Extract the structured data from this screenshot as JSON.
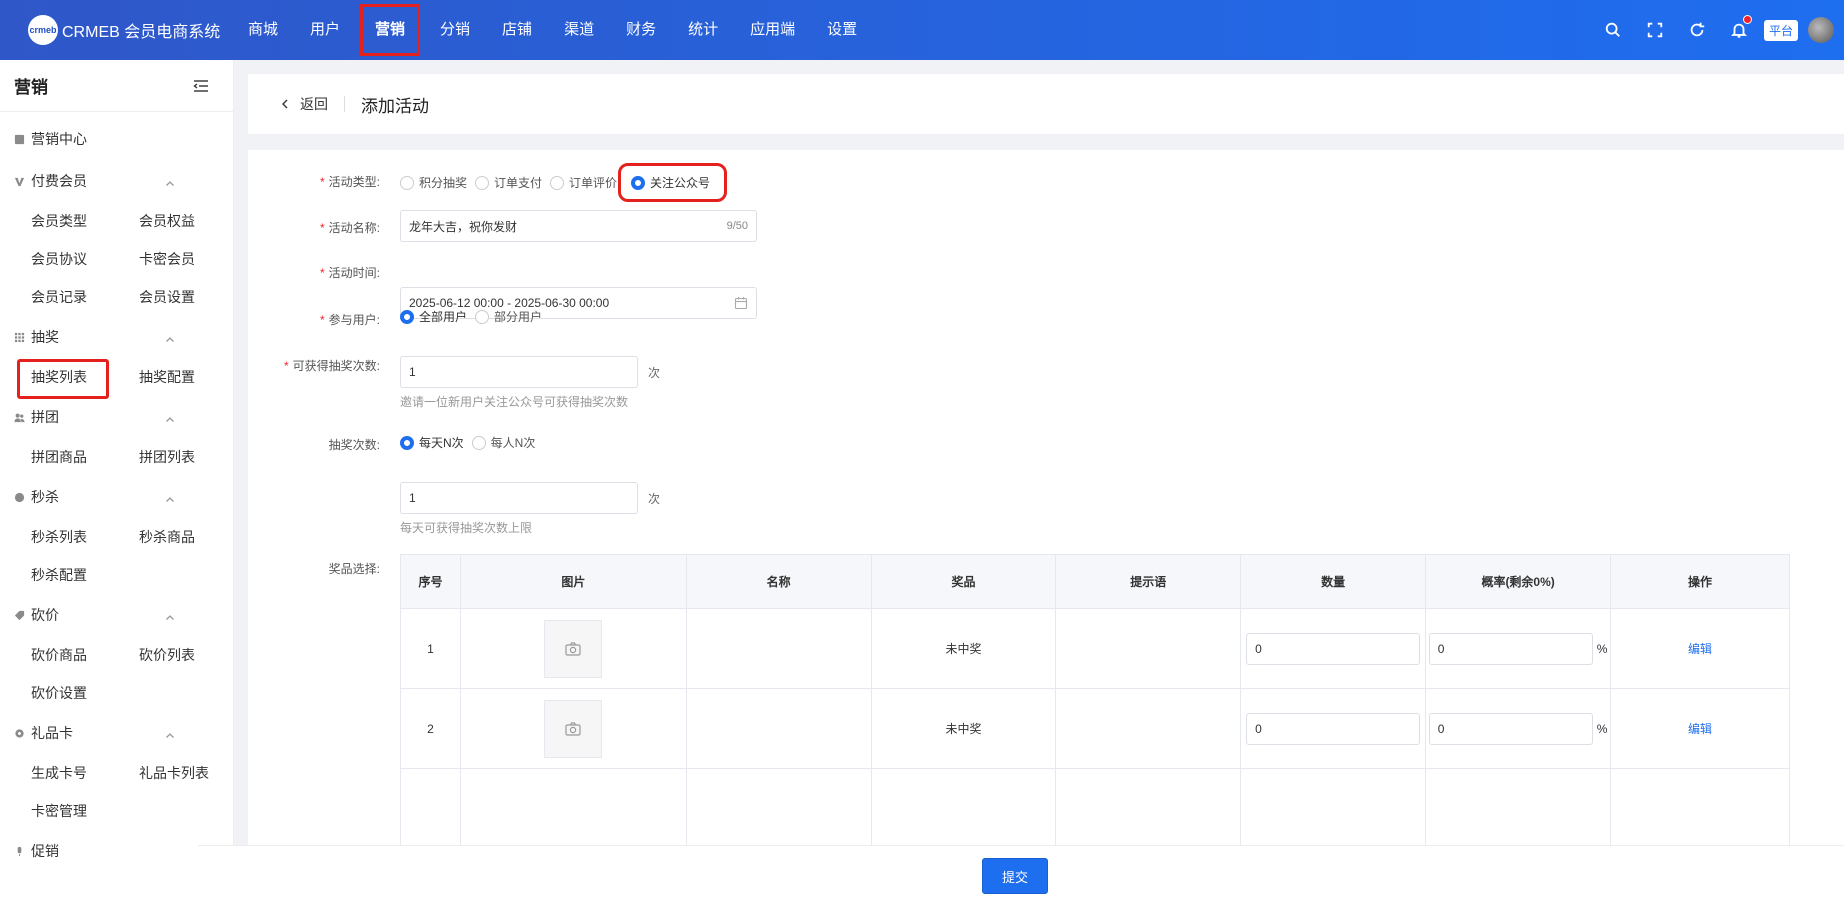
{
  "topbar": {
    "logo_badge": "crmeb",
    "logo_text": "CRMEB 会员电商系统",
    "nav": [
      "商城",
      "用户",
      "营销",
      "分销",
      "店铺",
      "渠道",
      "财务",
      "统计",
      "应用端",
      "设置"
    ],
    "active_nav": "营销",
    "platform_label": "平台"
  },
  "sidebar": {
    "title": "营销",
    "center_label": "营销中心",
    "groups": [
      {
        "title": "付费会员",
        "items": [
          "会员类型",
          "会员权益",
          "会员协议",
          "卡密会员",
          "会员记录",
          "会员设置"
        ]
      },
      {
        "title": "抽奖",
        "items": [
          "抽奖列表",
          "抽奖配置"
        ]
      },
      {
        "title": "拼团",
        "items": [
          "拼团商品",
          "拼团列表"
        ]
      },
      {
        "title": "秒杀",
        "items": [
          "秒杀列表",
          "秒杀商品",
          "秒杀配置"
        ]
      },
      {
        "title": "砍价",
        "items": [
          "砍价商品",
          "砍价列表",
          "砍价设置"
        ]
      },
      {
        "title": "礼品卡",
        "items": [
          "生成卡号",
          "礼品卡列表",
          "卡密管理"
        ]
      },
      {
        "title": "促销",
        "items": []
      }
    ]
  },
  "page": {
    "back_label": "返回",
    "title": "添加活动"
  },
  "form": {
    "type_label": "活动类型:",
    "type_options": [
      "积分抽奖",
      "订单支付",
      "订单评价",
      "关注公众号"
    ],
    "type_selected": "关注公众号",
    "name_label": "活动名称:",
    "name_value": "龙年大吉，祝你发财",
    "name_count": "9/50",
    "time_label": "活动时间:",
    "time_value": "2025-06-12 00:00 - 2025-06-30 00:00",
    "users_label": "参与用户:",
    "users_options": [
      "全部用户",
      "部分用户"
    ],
    "users_selected": "全部用户",
    "gain_label": "可获得抽奖次数:",
    "gain_value": "1",
    "gain_unit": "次",
    "gain_hint": "邀请一位新用户关注公众号可获得抽奖次数",
    "times_label": "抽奖次数:",
    "times_options": [
      "每天N次",
      "每人N次"
    ],
    "times_selected": "每天N次",
    "times_value": "1",
    "times_unit": "次",
    "times_hint": "每天可获得抽奖次数上限",
    "prize_label": "奖品选择:"
  },
  "table": {
    "headers": [
      "序号",
      "图片",
      "名称",
      "奖品",
      "提示语",
      "数量",
      "概率(剩余0%)",
      "操作"
    ],
    "rows": [
      {
        "index": "1",
        "name": "",
        "prize": "未中奖",
        "tip": "",
        "qty": "0",
        "rate": "0",
        "pct": "%",
        "action": "编辑"
      },
      {
        "index": "2",
        "name": "",
        "prize": "未中奖",
        "tip": "",
        "qty": "0",
        "rate": "0",
        "pct": "%",
        "action": "编辑"
      }
    ]
  },
  "footer": {
    "submit_label": "提交"
  },
  "colors": {
    "primary": "#1e6ef0",
    "highlight": "#e5211e",
    "required": "#f5222d"
  }
}
